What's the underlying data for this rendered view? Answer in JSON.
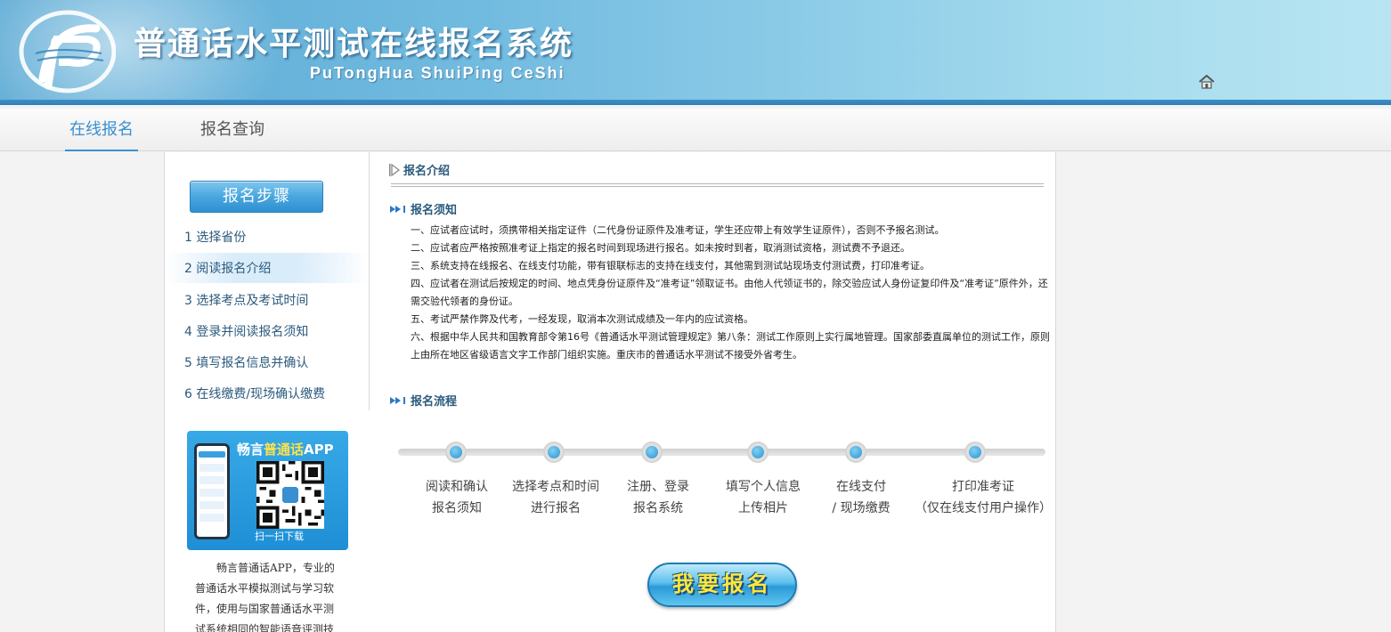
{
  "header": {
    "title": "普通话水平测试在线报名系统",
    "subtitle": "PuTongHua ShuiPing CeShi",
    "home_icon": "home-icon"
  },
  "nav": {
    "tabs": [
      {
        "label": "在线报名",
        "active": true
      },
      {
        "label": "报名查询",
        "active": false
      }
    ]
  },
  "sidebar": {
    "title": "报名步骤",
    "steps": [
      {
        "label": "1 选择省份"
      },
      {
        "label": "2 阅读报名介绍",
        "active": true
      },
      {
        "label": "3 选择考点及考试时间"
      },
      {
        "label": "4 登录并阅读报名须知"
      },
      {
        "label": "5 填写报名信息并确认"
      },
      {
        "label": "6 在线缴费/现场确认缴费"
      }
    ],
    "app": {
      "brand": "畅言",
      "highlight": "普通话",
      "suffix": "APP",
      "scan": "扫一扫下载",
      "description": "畅言普通话APP，专业的普通话水平模拟测试与学习软件，使用与国家普通话水平测试系统相同的智能语音评测技"
    }
  },
  "content": {
    "section_title": "报名介绍",
    "notice_title": "报名须知",
    "notices": [
      "一、应试者应试时，须携带相关指定证件（二代身份证原件及准考证，学生还应带上有效学生证原件），否则不予报名测试。",
      "二、应试者应严格按照准考证上指定的报名时间到现场进行报名。如未按时到者，取消测试资格，测试费不予退还。",
      "三、系统支持在线报名、在线支付功能，带有银联标志的支持在线支付，其他需到测试站现场支付测试费，打印准考证。",
      "四、应试者在测试后按规定的时间、地点凭身份证原件及“准考证”领取证书。由他人代领证书的，除交验应试人身份证复印件及“准考证”原件外，还需交验代领者的身份证。",
      "五、考试严禁作弊及代考，一经发现，取消本次测试成绩及一年内的应试资格。",
      "六、根据中华人民共和国教育部令第16号《普通话水平测试管理规定》第八条：测试工作原则上实行属地管理。国家部委直属单位的测试工作，原则上由所在地区省级语言文字工作部门组织实施。重庆市的普通话水平测试不接受外省考生。"
    ],
    "flow_title": "报名流程",
    "flow_steps": [
      {
        "line1": "阅读和确认",
        "line2": "报名须知"
      },
      {
        "line1": "选择考点和时间",
        "line2": "进行报名"
      },
      {
        "line1": "注册、登录",
        "line2": "报名系统"
      },
      {
        "line1": "填写个人信息",
        "line2": "上传相片"
      },
      {
        "line1": "在线支付",
        "line2": "/ 现场缴费"
      },
      {
        "line1": "打印准考证",
        "line2": "（仅在线支付用户操作）"
      }
    ],
    "apply_button": "我要报名"
  },
  "colors": {
    "accent": "#3a8fd0",
    "step_text": "#2b5a7d",
    "button_text": "#ffe83a"
  }
}
